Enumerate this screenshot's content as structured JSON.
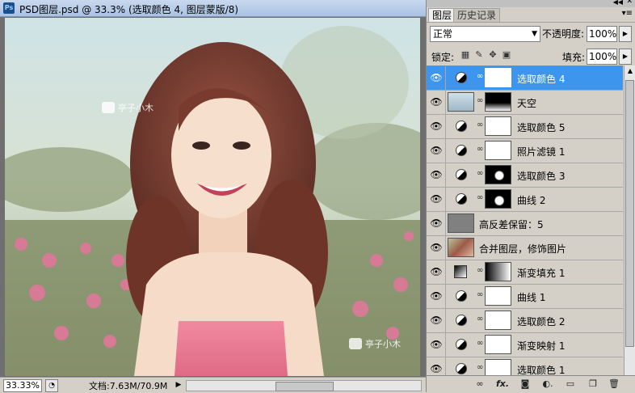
{
  "document": {
    "title": "PSD图层.psd @ 33.3% (选取颜色 4, 图层蒙版/8)",
    "zoom": "33.33%",
    "doc_info": "文档:7.63M/70.9M",
    "watermark_text": "亭子小木"
  },
  "panel": {
    "tabs": [
      "图层",
      "历史记录"
    ],
    "blend_mode": "正常",
    "opacity_label": "不透明度:",
    "opacity_value": "100%",
    "lock_label": "锁定:",
    "fill_label": "填充:",
    "fill_value": "100%",
    "selected_color": "#3d95ee",
    "layers": [
      {
        "name": "选取颜色 4",
        "icon": "adjustment",
        "mask": "white",
        "selected": true
      },
      {
        "name": "天空",
        "icon": "sky-thumbnail",
        "mask": "dark-top",
        "selected": false
      },
      {
        "name": "选取颜色 5",
        "icon": "adjustment",
        "mask": "white",
        "selected": false
      },
      {
        "name": "照片滤镜 1",
        "icon": "adjustment",
        "mask": "white",
        "selected": false
      },
      {
        "name": "选取颜色 3",
        "icon": "adjustment",
        "mask": "black-spot",
        "selected": false
      },
      {
        "name": "曲线 2",
        "icon": "adjustment",
        "mask": "black-spot",
        "selected": false
      },
      {
        "name": "高反差保留：5",
        "icon": "gray-thumbnail",
        "mask": "none",
        "selected": false
      },
      {
        "name": "合并图层，修饰图片",
        "icon": "photo-thumbnail",
        "mask": "none",
        "selected": false
      },
      {
        "name": "渐变填充 1",
        "icon": "gradient-fill",
        "mask": "gradient",
        "selected": false
      },
      {
        "name": "曲线 1",
        "icon": "adjustment",
        "mask": "white",
        "selected": false
      },
      {
        "name": "选取颜色 2",
        "icon": "adjustment",
        "mask": "white",
        "selected": false
      },
      {
        "name": "渐变映射 1",
        "icon": "adjustment",
        "mask": "white",
        "selected": false
      },
      {
        "name": "选取颜色 1",
        "icon": "adjustment",
        "mask": "white",
        "selected": false
      }
    ],
    "bottom_icons": [
      "link-icon",
      "fx-icon",
      "mask-icon",
      "adjustment-icon",
      "group-icon",
      "new-layer-icon",
      "trash-icon"
    ]
  }
}
